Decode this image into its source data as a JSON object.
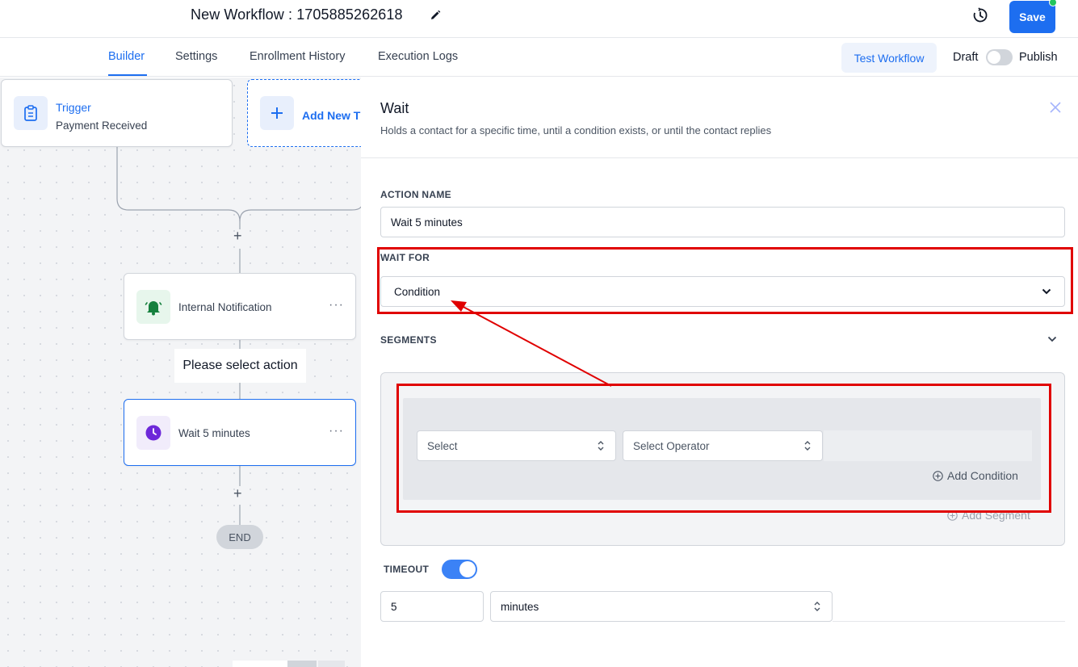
{
  "header": {
    "title": "New Workflow : 1705885262618",
    "save_label": "Save"
  },
  "tabs": [
    {
      "label": "Builder",
      "active": true
    },
    {
      "label": "Settings"
    },
    {
      "label": "Enrollment History"
    },
    {
      "label": "Execution Logs"
    }
  ],
  "toolbar": {
    "test_label": "Test Workflow",
    "draft_label": "Draft",
    "publish_label": "Publish"
  },
  "canvas": {
    "trigger": {
      "title": "Trigger",
      "subtitle": "Payment Received"
    },
    "add_trigger_label": "Add New T",
    "nodes": [
      {
        "label": "Internal Notification",
        "icon": "bell-icon",
        "menu": "···"
      },
      {
        "label": "Wait 5 minutes",
        "icon": "clock-icon",
        "menu": "···"
      }
    ],
    "tooltip": "Please select action",
    "end_label": "END"
  },
  "panel": {
    "title": "Wait",
    "description": "Holds a contact for a specific time, until a condition exists, or until the contact replies",
    "action_name_label": "ACTION NAME",
    "action_name_value": "Wait 5 minutes",
    "wait_for_label": "WAIT FOR",
    "wait_for_value": "Condition",
    "segments_label": "SEGMENTS",
    "select_placeholder": "Select",
    "operator_placeholder": "Select Operator",
    "add_condition_label": "Add Condition",
    "add_segment_label": "Add Segment",
    "timeout_label": "TIMEOUT",
    "timeout_enabled": true,
    "timeout_value": "5",
    "timeout_unit": "minutes"
  },
  "colors": {
    "accent": "#1d6ef0",
    "annotation": "#e00000",
    "wait_icon": "#6d28d9",
    "notify_icon": "#15803d"
  }
}
